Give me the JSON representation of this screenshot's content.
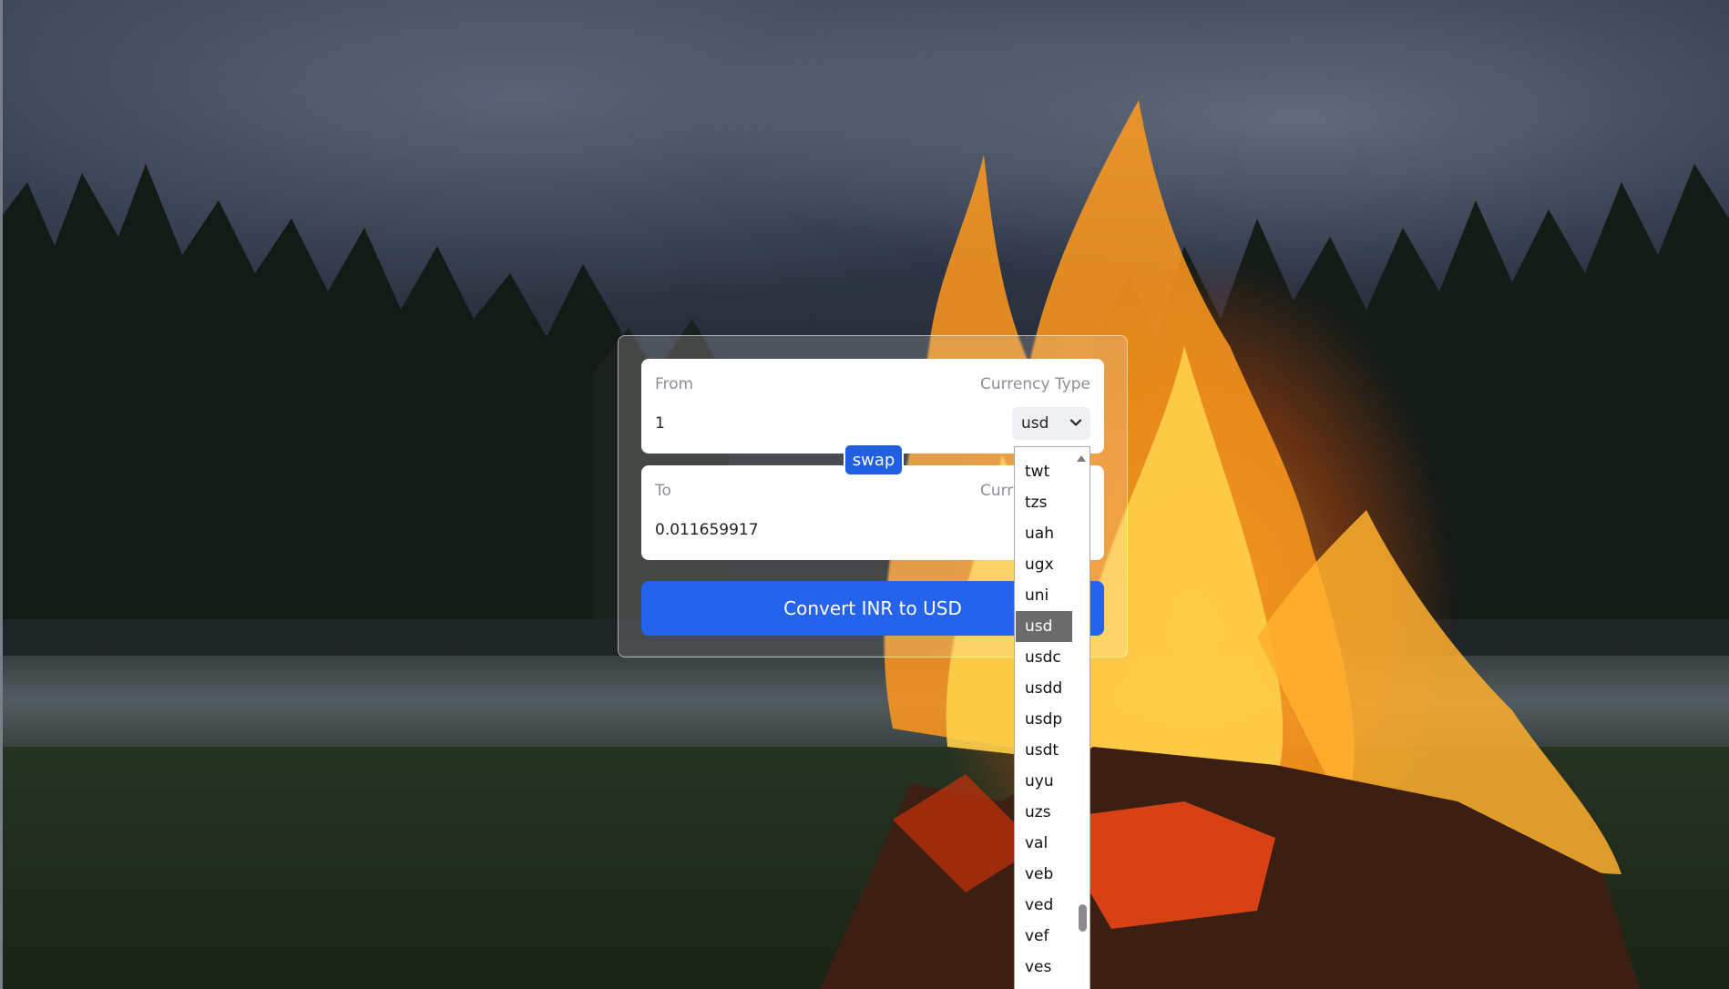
{
  "converter": {
    "from": {
      "label": "From",
      "currency_label": "Currency Type",
      "amount": "1",
      "currency": "usd"
    },
    "to": {
      "label": "To",
      "currency_label": "Currency Type",
      "amount": "0.011659917"
    },
    "swap_label": "swap",
    "convert_label": "Convert INR to USD"
  },
  "dropdown": {
    "selected": "usd",
    "options": [
      "twt",
      "tzs",
      "uah",
      "ugx",
      "uni",
      "usd",
      "usdc",
      "usdd",
      "usdp",
      "usdt",
      "uyu",
      "uzs",
      "val",
      "veb",
      "ved",
      "vef",
      "ves"
    ]
  },
  "colors": {
    "primary": "#2463eb",
    "swap": "#1f5fe0",
    "selected_option": "#6b6b6b"
  },
  "icons": {
    "select_arrow": "chevron-down-icon",
    "scroll_up": "triangle-up-icon"
  }
}
